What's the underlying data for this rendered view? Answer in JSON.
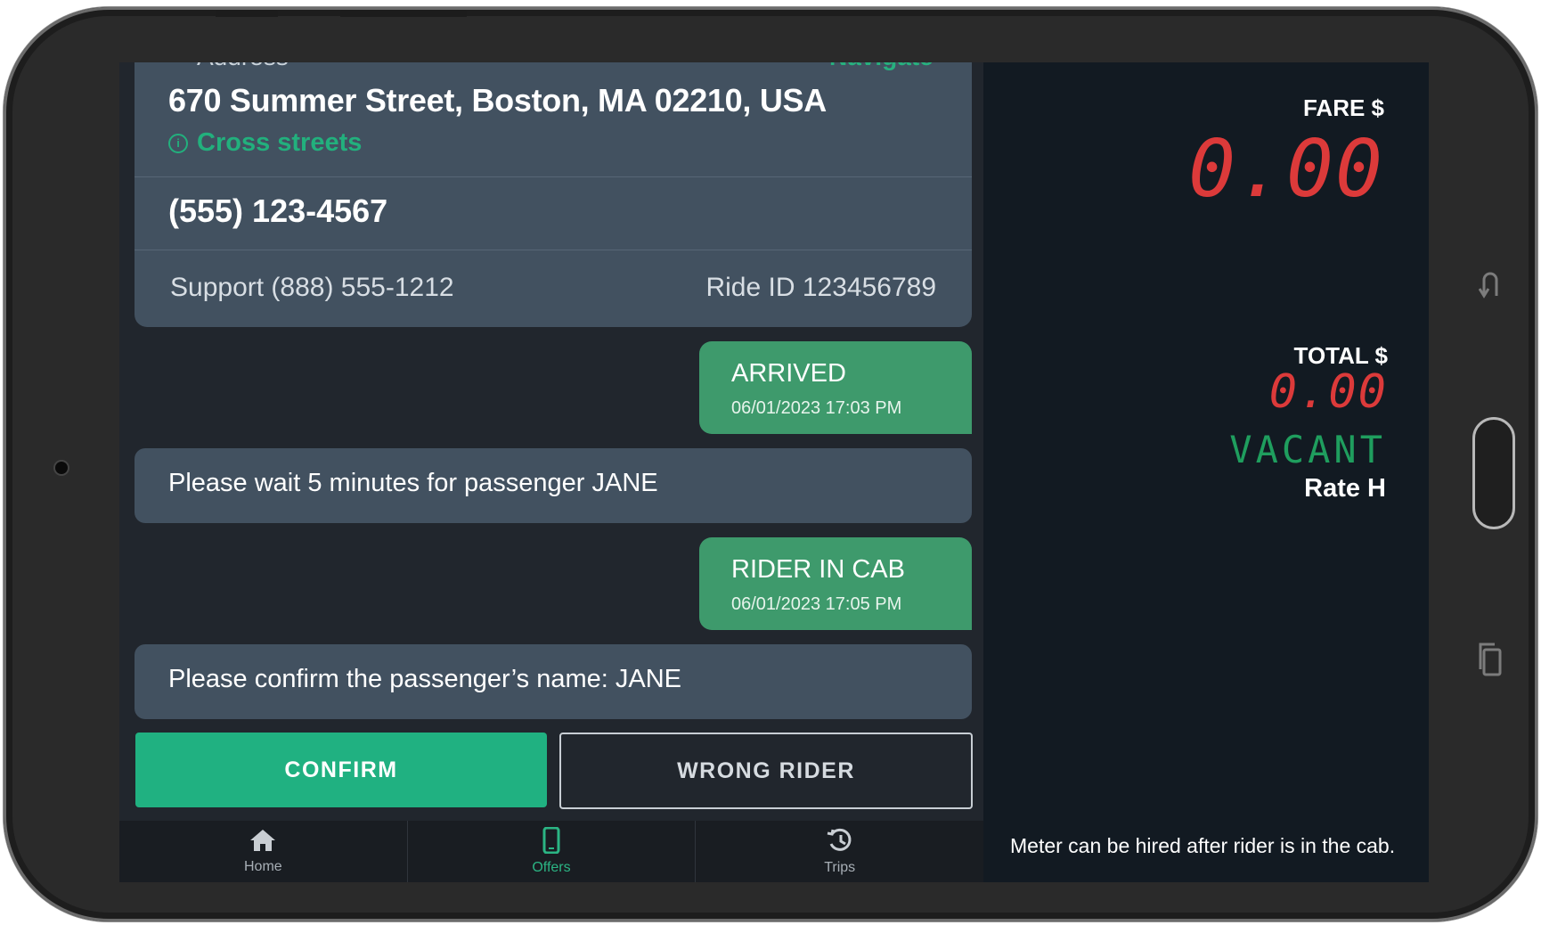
{
  "ride": {
    "address_label": "Address",
    "navigate_label": "Navigate",
    "address": "670 Summer Street, Boston, MA 02210, USA",
    "cross_streets": "Cross streets",
    "phone": "(555) 123-4567",
    "support": "Support (888) 555-1212",
    "ride_id": "Ride ID 123456789"
  },
  "timeline": {
    "arrived": {
      "title": "ARRIVED",
      "time": "06/01/2023 17:03 PM"
    },
    "wait_message": "Please wait 5 minutes for passenger JANE",
    "rider_in_cab": {
      "title": "RIDER IN CAB",
      "time": "06/01/2023 17:05 PM"
    },
    "confirm_message": "Please confirm the passenger’s name: JANE"
  },
  "actions": {
    "confirm_label": "CONFIRM",
    "wrong_rider_label": "WRONG RIDER"
  },
  "nav": {
    "home": "Home",
    "offers": "Offers",
    "trips": "Trips",
    "active": "Offers"
  },
  "meter": {
    "fare_label": "FARE $",
    "fare_value": "0.00",
    "total_label": "TOTAL $",
    "total_value": "0.00",
    "status": "VACANT",
    "rate": "Rate H",
    "hint": "Meter can be hired after rider is in the cab."
  },
  "colors": {
    "accent_green": "#20b181",
    "status_green": "#3e9a6c",
    "meter_red": "#dc3a3a",
    "vacant_green": "#1f9e5e",
    "card_bg": "#425160",
    "screen_bg": "#21262d",
    "meter_bg": "#121a22"
  },
  "icons": {
    "home": "home-icon",
    "offers": "phone-icon",
    "trips": "history-icon",
    "cross_streets": "info-icon",
    "back": "back-icon",
    "recents": "recents-icon"
  }
}
